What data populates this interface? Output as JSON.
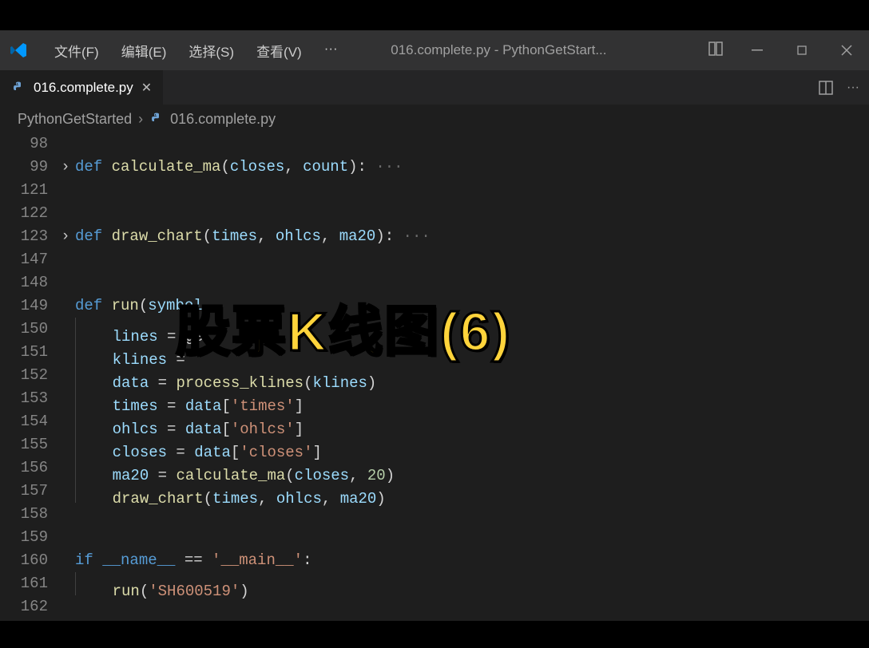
{
  "title_bar": {
    "menus": [
      "文件(F)",
      "编辑(E)",
      "选择(S)",
      "查看(V)"
    ],
    "more": "···",
    "window_title": "016.complete.py - PythonGetStart..."
  },
  "tab": {
    "label": "016.complete.py"
  },
  "breadcrumb": {
    "root": "PythonGetStarted",
    "file": "016.complete.py"
  },
  "overlay_text": "股票K线图(6)",
  "code_lines": [
    {
      "n": 98,
      "fold": "",
      "html": ""
    },
    {
      "n": 99,
      "fold": ">",
      "hl": true,
      "html": "<span class='kw'>def</span> <span class='fn'>calculate_ma</span>(<span class='var'>closes</span>, <span class='var'>count</span>): <span class='dots'>···</span>"
    },
    {
      "n": 121,
      "fold": "",
      "html": ""
    },
    {
      "n": 122,
      "fold": "",
      "html": ""
    },
    {
      "n": 123,
      "fold": ">",
      "hl": true,
      "html": "<span class='kw'>def</span> <span class='fn'>draw_chart</span>(<span class='var'>times</span>, <span class='var'>ohlcs</span>, <span class='var'>ma20</span>): <span class='dots'>···</span>"
    },
    {
      "n": 147,
      "fold": "",
      "html": ""
    },
    {
      "n": 148,
      "fold": "",
      "html": ""
    },
    {
      "n": 149,
      "fold": "",
      "html": "<span class='kw'>def</span> <span class='fn'>run</span>(<span class='var'>symbol</span>"
    },
    {
      "n": 150,
      "fold": "",
      "html": "    <span class='var'>lines</span> = ge"
    },
    {
      "n": 151,
      "fold": "",
      "html": "    <span class='var'>klines</span> = "
    },
    {
      "n": 152,
      "fold": "",
      "html": "    <span class='var'>data</span> = <span class='fn'>process_klines</span>(<span class='var'>klines</span>)"
    },
    {
      "n": 153,
      "fold": "",
      "html": "    <span class='var'>times</span> = <span class='var'>data</span>[<span class='str'>'times'</span>]"
    },
    {
      "n": 154,
      "fold": "",
      "html": "    <span class='var'>ohlcs</span> = <span class='var'>data</span>[<span class='str'>'ohlcs'</span>]"
    },
    {
      "n": 155,
      "fold": "",
      "html": "    <span class='var'>closes</span> = <span class='var'>data</span>[<span class='str'>'closes'</span>]"
    },
    {
      "n": 156,
      "fold": "",
      "html": "    <span class='var'>ma20</span> = <span class='fn'>calculate_ma</span>(<span class='var'>closes</span>, <span class='num'>20</span>)"
    },
    {
      "n": 157,
      "fold": "",
      "html": "    <span class='fn'>draw_chart</span>(<span class='var'>times</span>, <span class='var'>ohlcs</span>, <span class='var'>ma20</span>)"
    },
    {
      "n": 158,
      "fold": "",
      "html": ""
    },
    {
      "n": 159,
      "fold": "",
      "html": ""
    },
    {
      "n": 160,
      "fold": "",
      "html": "<span class='kw'>if</span> <span class='cmp'>__name__</span> == <span class='str'>'__main__'</span>:"
    },
    {
      "n": 161,
      "fold": "",
      "html": "    <span class='fn'>run</span>(<span class='str'>'SH600519'</span>)"
    },
    {
      "n": 162,
      "fold": "",
      "html": ""
    }
  ]
}
